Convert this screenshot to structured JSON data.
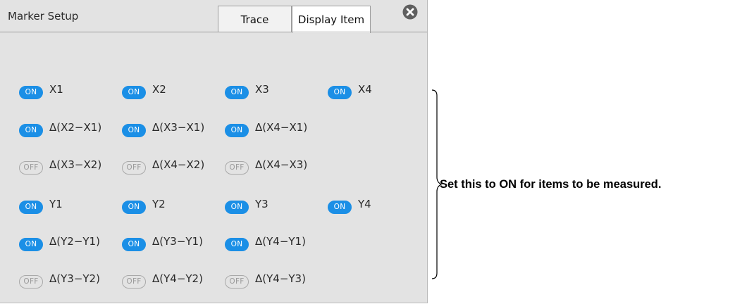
{
  "dialog": {
    "title": "Marker Setup",
    "tabs": [
      {
        "label": "Trace",
        "active": false
      },
      {
        "label": "Display Item",
        "active": true
      }
    ],
    "close_icon": "close-circle-icon"
  },
  "toggle_text": {
    "on": "ON",
    "off": "OFF"
  },
  "rows": [
    [
      {
        "label": "X1",
        "on": true
      },
      {
        "label": "X2",
        "on": true
      },
      {
        "label": "X3",
        "on": true
      },
      {
        "label": "X4",
        "on": true
      }
    ],
    [
      {
        "label": "Δ(X2−X1)",
        "on": true
      },
      {
        "label": "Δ(X3−X1)",
        "on": true
      },
      {
        "label": "Δ(X4−X1)",
        "on": true
      }
    ],
    [
      {
        "label": "Δ(X3−X2)",
        "on": false
      },
      {
        "label": "Δ(X4−X2)",
        "on": false
      },
      {
        "label": "Δ(X4−X3)",
        "on": false
      }
    ],
    [
      {
        "label": "Y1",
        "on": true
      },
      {
        "label": "Y2",
        "on": true
      },
      {
        "label": "Y3",
        "on": true
      },
      {
        "label": "Y4",
        "on": true
      }
    ],
    [
      {
        "label": "Δ(Y2−Y1)",
        "on": true
      },
      {
        "label": "Δ(Y3−Y1)",
        "on": true
      },
      {
        "label": "Δ(Y4−Y1)",
        "on": true
      }
    ],
    [
      {
        "label": "Δ(Y3−Y2)",
        "on": false
      },
      {
        "label": "Δ(Y4−Y2)",
        "on": false
      },
      {
        "label": "Δ(Y4−Y3)",
        "on": false
      }
    ]
  ],
  "annotation": "Set this to ON for items to be measured.",
  "colors": {
    "on": "#1b8fe6",
    "panel": "#e3e3e3"
  }
}
